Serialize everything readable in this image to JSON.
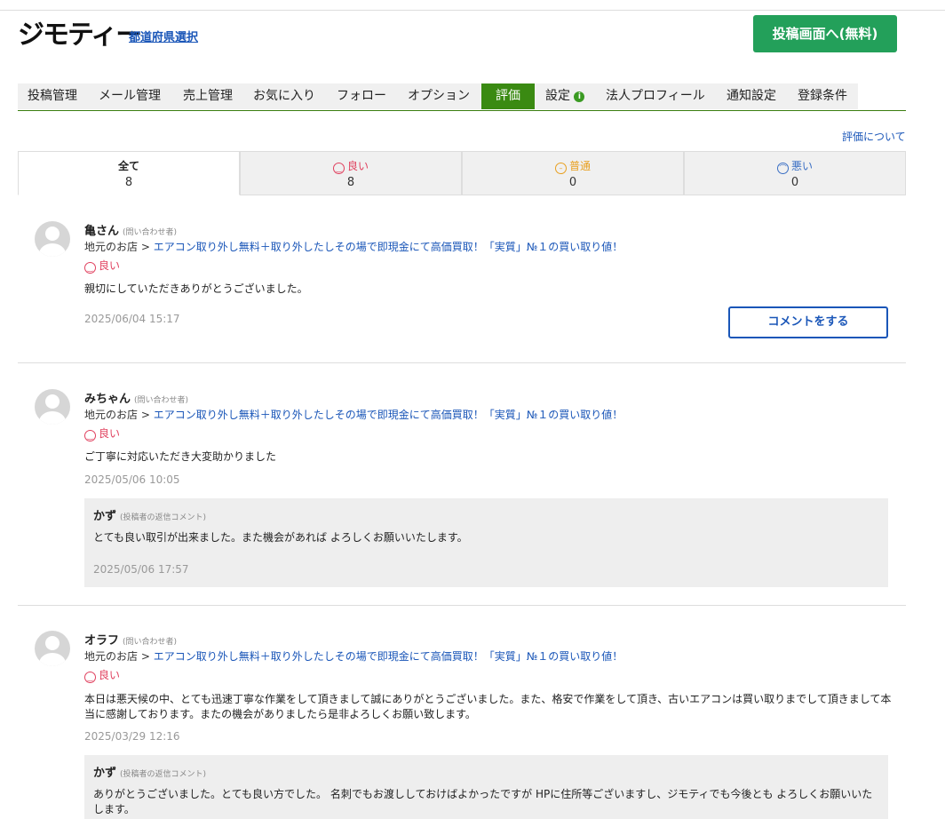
{
  "header": {
    "logo": "ジモティー",
    "prefecture_link": "都道府県選択",
    "post_button": "投稿画面へ(無料)"
  },
  "nav": {
    "items": [
      "投稿管理",
      "メール管理",
      "売上管理",
      "お気に入り",
      "フォロー",
      "オプション",
      "評価",
      "設定",
      "法人プロフィール",
      "通知設定",
      "登録条件"
    ],
    "active": "評価"
  },
  "about_link": "評価について",
  "tabs": [
    {
      "label": "全て",
      "count": "8"
    },
    {
      "label": "良い",
      "count": "8"
    },
    {
      "label": "普通",
      "count": "0"
    },
    {
      "label": "悪い",
      "count": "0"
    }
  ],
  "colors": {
    "good": "#e0405e",
    "normal": "#e8a020",
    "bad": "#3a6fc4",
    "accent": "#3a8a12",
    "post_button": "#23a05a"
  },
  "reviews": [
    {
      "name": "亀さん",
      "role": "(問い合わせ者)",
      "shop": "地元のお店",
      "separator": ">",
      "listing": "エアコン取り外し無料＋取り外したしその場で即現金にて高価買取！「実質」№１の買い取り値！",
      "rating": "良い",
      "text": "親切にしていただきありがとうございました。",
      "date": "2025/06/04 15:17",
      "comment_button": "コメントをする"
    },
    {
      "name": "みちゃん",
      "role": "(問い合わせ者)",
      "shop": "地元のお店",
      "separator": ">",
      "listing": "エアコン取り外し無料＋取り外したしその場で即現金にて高価買取！「実質」№１の買い取り値！",
      "rating": "良い",
      "text": "ご丁寧に対応いただき大変助かりました",
      "date": "2025/05/06 10:05",
      "reply": {
        "name": "かず",
        "role": "(投稿者の返信コメント)",
        "text": "とても良い取引が出来ました。また機会があれば よろしくお願いいたします。",
        "date": "2025/05/06 17:57"
      }
    },
    {
      "name": "オラフ",
      "role": "(問い合わせ者)",
      "shop": "地元のお店",
      "separator": ">",
      "listing": "エアコン取り外し無料＋取り外したしその場で即現金にて高価買取！「実質」№１の買い取り値！",
      "rating": "良い",
      "text": "本日は悪天候の中、とても迅速丁寧な作業をして頂きまして誠にありがとうございました。また、格安で作業をして頂き、古いエアコンは買い取りまでして頂きまして本当に感謝しております。またの機会がありましたら是非よろしくお願い致します。",
      "date": "2025/03/29 12:16",
      "reply": {
        "name": "かず",
        "role": "(投稿者の返信コメント)",
        "text": "ありがとうございました。とても良い方でした。 名刺でもお渡ししておけばよかったですが HPに住所等ございますし、ジモティでも今後とも よろしくお願いいたします。"
      }
    }
  ]
}
